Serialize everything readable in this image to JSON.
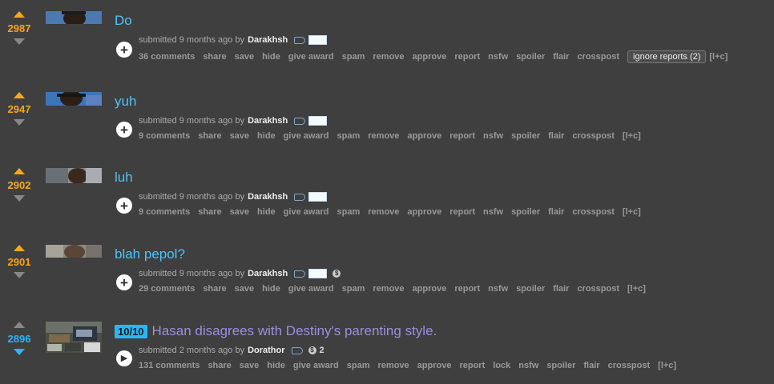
{
  "posts": [
    {
      "score": "2987",
      "title": "Do",
      "submitted": "submitted 9 months ago by",
      "author": "Darakhsh",
      "comments": "36 comments",
      "expando": "+",
      "ignore_reports": "ignore reports (2)"
    },
    {
      "score": "2947",
      "title": "yuh",
      "submitted": "submitted 9 months ago by",
      "author": "Darakhsh",
      "comments": "9 comments",
      "expando": "+"
    },
    {
      "score": "2902",
      "title": "luh",
      "submitted": "submitted 9 months ago by",
      "author": "Darakhsh",
      "comments": "9 comments",
      "expando": "+"
    },
    {
      "score": "2901",
      "title": "blah pepol?",
      "submitted": "submitted 9 months ago by",
      "author": "Darakhsh",
      "comments": "29 comments",
      "expando": "+"
    },
    {
      "score": "2896",
      "flair": "10/10",
      "title": "Hasan disagrees with Destiny's parenting style.",
      "submitted": "submitted 2 months ago by",
      "author": "Dorathor",
      "gild_count": "2",
      "comments": "131 comments",
      "expando": "▶"
    }
  ],
  "actions": {
    "share": "share",
    "save": "save",
    "hide": "hide",
    "give_award": "give award",
    "spam": "spam",
    "remove": "remove",
    "approve": "approve",
    "report": "report",
    "lock": "lock",
    "nsfw": "nsfw",
    "spoiler": "spoiler",
    "flair": "flair",
    "crosspost": "crosspost",
    "lc": "[l+c]"
  },
  "colors": {
    "background": "#3f3f3f",
    "upvote": "#f5a623",
    "downvote_active": "#29b6f6",
    "title_link": "#4fc3f7",
    "title_visited": "#9b8fdf"
  }
}
